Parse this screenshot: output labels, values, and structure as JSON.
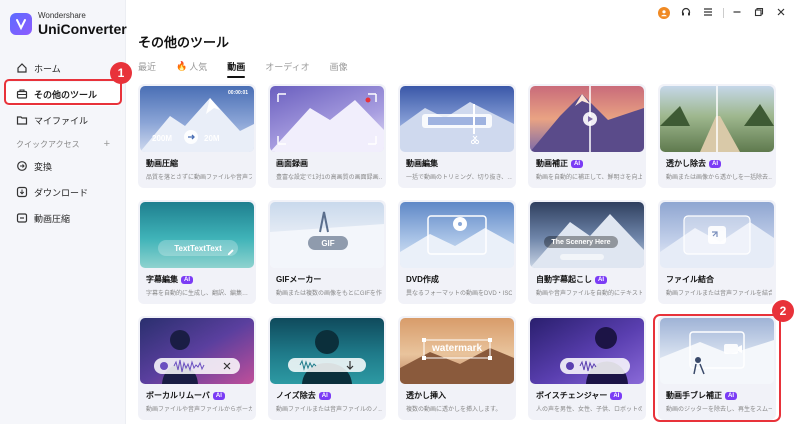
{
  "brand": {
    "sub": "Wondershare",
    "main": "UniConverter"
  },
  "sidebar": {
    "items": [
      {
        "label": "ホーム"
      },
      {
        "label": "その他のツール"
      },
      {
        "label": "マイファイル"
      }
    ],
    "group_label": "クイックアクセス",
    "group_add": "+",
    "quick": [
      {
        "label": "変換"
      },
      {
        "label": "ダウンロード"
      },
      {
        "label": "動画圧縮"
      }
    ]
  },
  "page_title": "その他のツール",
  "tabs": [
    {
      "label": "最近"
    },
    {
      "label": "人気"
    },
    {
      "label": "動画"
    },
    {
      "label": "オーディオ"
    },
    {
      "label": "画像"
    }
  ],
  "callouts": {
    "one": "1",
    "two": "2"
  },
  "thumb_text": {
    "size_from": "200M",
    "size_to": "20M",
    "rec_time": "00:00:01",
    "subtitle_text": "TextTextText",
    "gif": "GIF",
    "scenery": "The Scenery Here",
    "watermark": "watermark"
  },
  "cards": [
    {
      "title": "動画圧縮",
      "ai": "",
      "desc": "品質を落とさずに動画ファイルや音声ファイ…"
    },
    {
      "title": "画面録画",
      "ai": "",
      "desc": "豊富な設定で1対1の高画質の画面録画…"
    },
    {
      "title": "動画編集",
      "ai": "",
      "desc": "一括で動画のトリミング、切り抜き、…"
    },
    {
      "title": "動画補正",
      "ai": "AI",
      "desc": "動画を自動的に補正して、鮮明さを向上…"
    },
    {
      "title": "透かし除去",
      "ai": "AI",
      "desc": "動画または画像から透かしを一括除去…"
    },
    {
      "title": "字幕編集",
      "ai": "AI",
      "desc": "字幕を自動的に生成し、翻訳、編集…"
    },
    {
      "title": "GIFメーカー",
      "ai": "",
      "desc": "動画または複数の画像をもとにGIFを作…"
    },
    {
      "title": "DVD作成",
      "ai": "",
      "desc": "異なるフォーマットの動画をDVD・ISO…"
    },
    {
      "title": "自動字幕起こし",
      "ai": "AI",
      "desc": "動画や音声ファイルを自動的にテキストに…"
    },
    {
      "title": "ファイル結合",
      "ai": "",
      "desc": "動画ファイルまたは音声ファイルを結合…"
    },
    {
      "title": "ボーカルリムーバ",
      "ai": "AI",
      "desc": "動画ファイルや音声ファイルからボーカル…"
    },
    {
      "title": "ノイズ除去",
      "ai": "AI",
      "desc": "動画ファイルまたは音声ファイルのノ…"
    },
    {
      "title": "透かし挿入",
      "ai": "",
      "desc": "複数の動画に透かしを挿入します。"
    },
    {
      "title": "ボイスチェンジャー",
      "ai": "AI",
      "desc": "人の声を男性、女性、子供、ロボットの…"
    },
    {
      "title": "動画手ブレ補正",
      "ai": "AI",
      "desc": "動画のジッターを除去し、再生をスムーズ…"
    }
  ],
  "colors": {
    "accent": "#7b3cf5",
    "callout": "#e8323a",
    "sidebar_bg": "#f5f6fa",
    "card_bg": "#f1f2f8"
  }
}
